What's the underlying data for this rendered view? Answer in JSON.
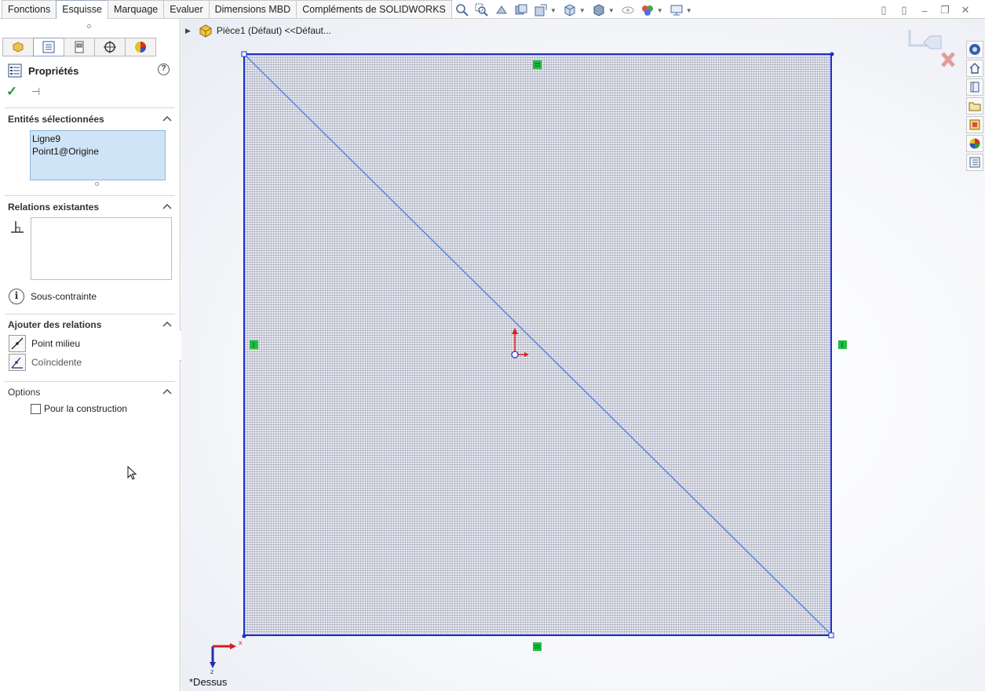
{
  "tabs": [
    "Fonctions",
    "Esquisse",
    "Marquage",
    "Evaluer",
    "Dimensions MBD",
    "Compléments de SOLIDWORKS"
  ],
  "active_tab": "Esquisse",
  "property_manager": {
    "title": "Propriétés",
    "sections": {
      "selected_entities": {
        "title": "Entités sélectionnées",
        "items": [
          "Ligne9",
          "Point1@Origine"
        ]
      },
      "existing_relations": {
        "title": "Relations existantes",
        "status": "Sous-contrainte"
      },
      "add_relations": {
        "title": "Ajouter des relations",
        "items": [
          "Point milieu",
          "Coïncidente"
        ]
      },
      "options": {
        "title": "Options",
        "construction_label": "Pour la construction",
        "construction_checked": false
      }
    }
  },
  "feature_tree": {
    "part_label": "Pièce1 (Défaut) <<Défaut..."
  },
  "viewport": {
    "view_name": "*Dessus"
  },
  "colors": {
    "sketch_line": "#1a2fd0",
    "relation_badge": "#1fbf3f",
    "origin_red": "#e02020"
  }
}
